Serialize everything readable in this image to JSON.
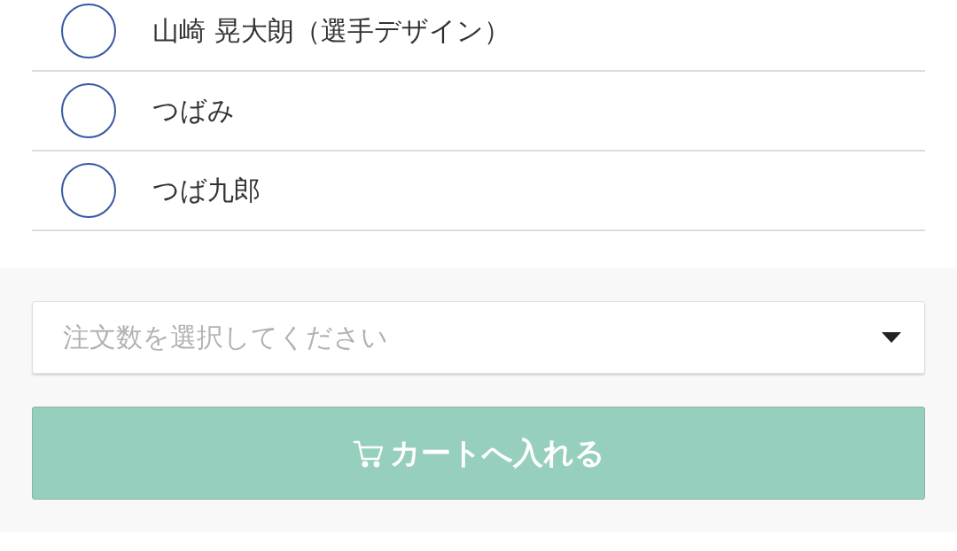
{
  "options": [
    {
      "label": "山崎 晃大朗（選手デザイン）",
      "selected": false
    },
    {
      "label": "つばみ",
      "selected": false
    },
    {
      "label": "つば九郎",
      "selected": false
    }
  ],
  "quantity_select": {
    "placeholder": "注文数を選択してください"
  },
  "cart_button": {
    "label": "カートへ入れる"
  }
}
